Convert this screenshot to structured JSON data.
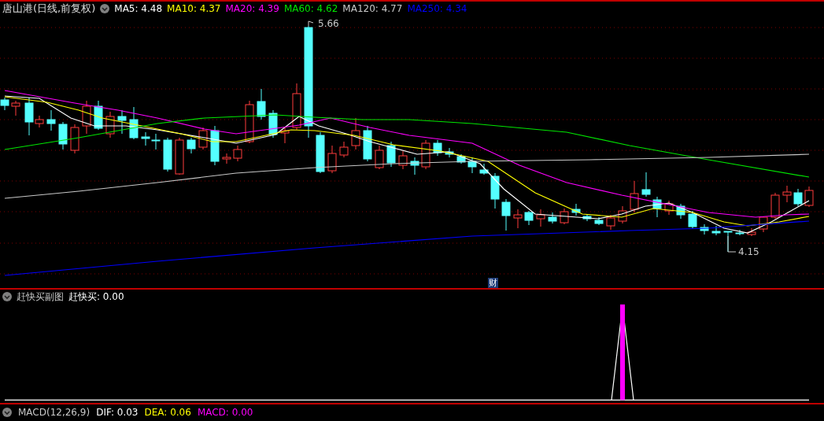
{
  "main_chart": {
    "title": "唐山港(日线,前复权)",
    "moving_averages": [
      {
        "text": "MA5: 4.48",
        "color": "#ffffff"
      },
      {
        "text": "MA10: 4.37",
        "color": "#ffff00"
      },
      {
        "text": "MA20: 4.39",
        "color": "#ff00ff"
      },
      {
        "text": "MA60: 4.62",
        "color": "#00e600"
      },
      {
        "text": "MA120: 4.77",
        "color": "#c8c8c8"
      },
      {
        "text": "MA250: 4.34",
        "color": "#0000ff"
      }
    ],
    "high_label": "5.66",
    "low_label": "4.15",
    "marker": "财"
  },
  "sub_chart": {
    "title": "赶快买副图",
    "reading": "赶快买: 0.00"
  },
  "macd_bar": [
    {
      "text": "MACD(12,26,9)",
      "color": "#c8c8c8"
    },
    {
      "text": "DIF: 0.03",
      "color": "#ffffff"
    },
    {
      "text": "DEA: 0.06",
      "color": "#ffff00"
    },
    {
      "text": "MACD: 0.00",
      "color": "#ff00ff"
    }
  ]
}
